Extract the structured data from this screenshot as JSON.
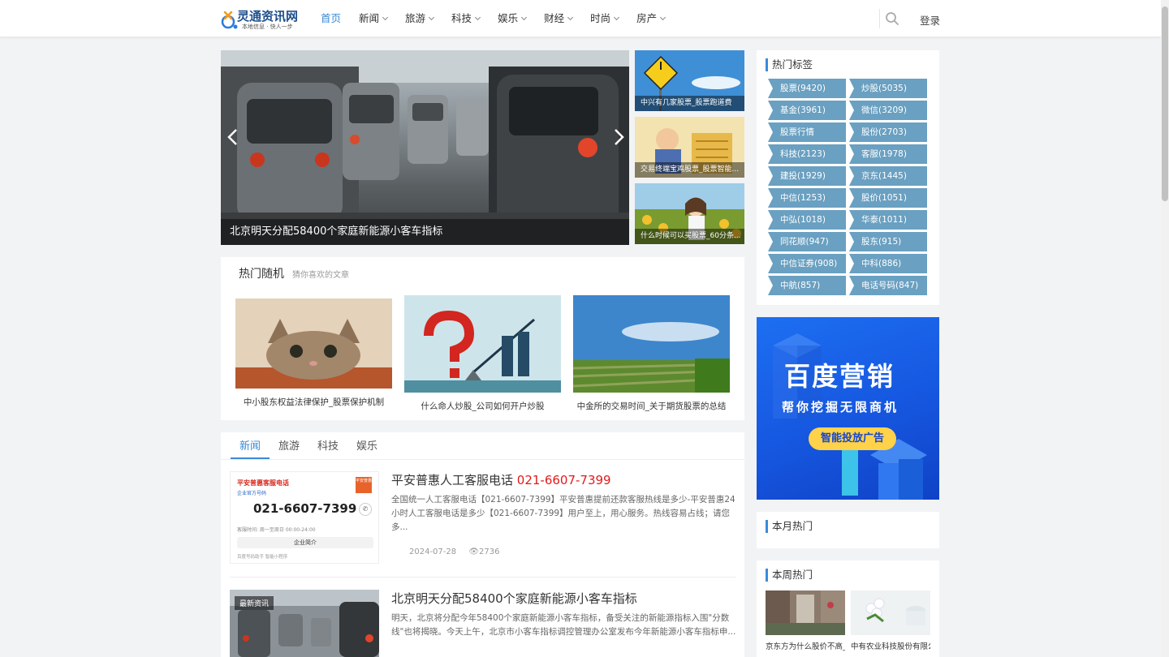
{
  "header": {
    "logo_title": "灵通资讯网",
    "logo_sub": "本地信息 · 快人一步",
    "nav": [
      {
        "label": "首页",
        "dropdown": false
      },
      {
        "label": "新闻",
        "dropdown": true
      },
      {
        "label": "旅游",
        "dropdown": true
      },
      {
        "label": "科技",
        "dropdown": true
      },
      {
        "label": "娱乐",
        "dropdown": true
      },
      {
        "label": "财经",
        "dropdown": true
      },
      {
        "label": "时尚",
        "dropdown": true
      },
      {
        "label": "房产",
        "dropdown": true
      }
    ],
    "search_icon": "search-icon",
    "login_label": "登录"
  },
  "slider": {
    "caption": "北京明天分配58400个家庭新能源小客车指标"
  },
  "side_thumbs": [
    {
      "caption": "中兴有几家股票_股票跑道费"
    },
    {
      "caption": "交易终端宝鸡股票_股票智能..."
    },
    {
      "caption": "什么时候可以买股票_60分条..."
    }
  ],
  "hot_random": {
    "title": "热门随机",
    "subtitle": "猜你喜欢的文章",
    "items": [
      {
        "caption": "中小股东权益法律保护_股票保护机制"
      },
      {
        "caption": "什么命人炒股_公司如何开户炒股"
      },
      {
        "caption": "中金所的交易时间_关于期货股票的总结"
      }
    ]
  },
  "news": {
    "tabs": [
      "新闻",
      "旅游",
      "科技",
      "娱乐"
    ],
    "active_tab": "新闻",
    "items": [
      {
        "title": "平安普惠人工客服电话",
        "title_phone": "021-6607-7399",
        "desc": "全国统一人工客服电话【021-6607-7399】平安普惠提前还款客服热线是多少-平安普惠24小时人工客服电话是多少【021-6607-7399】用户至上，用心服务。热线容易占线；请您多...",
        "date": "2024-07-28",
        "views": "2736",
        "thumb": {
          "brand": "平安普惠客服电话",
          "tag": "企业官方号码",
          "phone": "021-6607-7399",
          "hours": "客服时间: 周一至周日 00:00-24:00",
          "button": "企业简介",
          "footer": "百度号码助手 智能小程序",
          "logo": "平安普惠"
        }
      },
      {
        "title": "北京明天分配58400个家庭新能源小客车指标",
        "desc": "明天，北京将分配今年58400个家庭新能源小客车指标，备受关注的新能源指标入围\"分数线\"也将揭晓。今天上午，北京市小客车指标调控管理办公室发布今年新能源小客车指标申...",
        "badge": "最新资讯"
      }
    ]
  },
  "sidebar": {
    "tags_title": "热门标签",
    "tags": [
      "股票(9420)",
      "炒股(5035)",
      "基金(3961)",
      "微信(3209)",
      "股票行情",
      "股份(2703)",
      "科技(2123)",
      "客服(1978)",
      "建投(1929)",
      "京东(1445)",
      "中信(1253)",
      "股价(1051)",
      "中弘(1018)",
      "华泰(1011)",
      "同花顺(947)",
      "股东(915)",
      "中信证券(908)",
      "中科(886)",
      "中航(857)",
      "电话号码(847)"
    ],
    "ad": {
      "title": "百度营销",
      "subtitle": "帮你挖掘无限商机",
      "button": "智能投放广告"
    },
    "month_title": "本月热门",
    "week_title": "本周热门",
    "week_items": [
      {
        "caption": "京东方为什么股价不高_京东方股票行情"
      },
      {
        "caption": "中有农业科技股份有限公司怎么样_农业平台"
      }
    ]
  },
  "colors": {
    "accent": "#3b8ad9",
    "tag_bg": "#6aa0c1",
    "phone_red": "#e21b1b",
    "page_bg": "#f2f3f5"
  }
}
